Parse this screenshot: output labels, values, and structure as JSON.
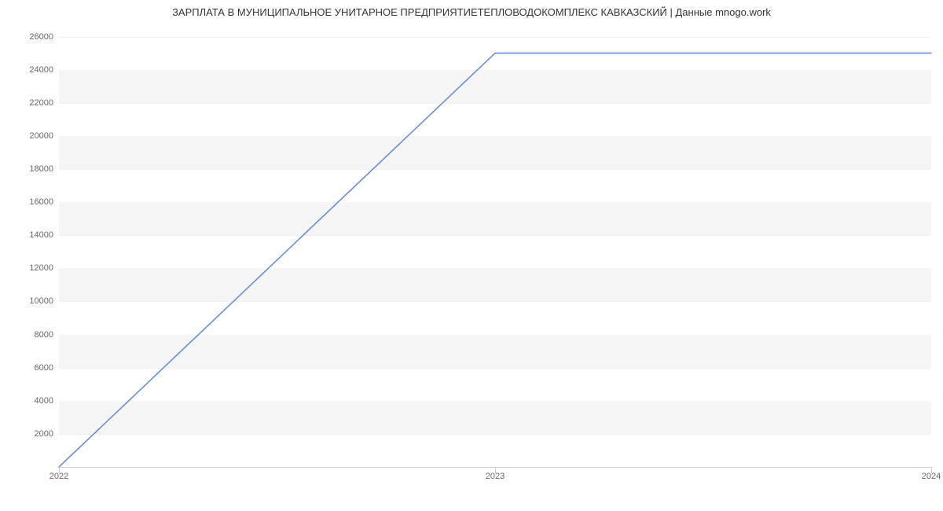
{
  "chart_data": {
    "type": "line",
    "title": "ЗАРПЛАТА В МУНИЦИПАЛЬНОЕ УНИТАРНОЕ ПРЕДПРИЯТИЕТЕПЛОВОДОКОМПЛЕКС КАВКАЗСКИЙ | Данные mnogo.work",
    "xlabel": "",
    "ylabel": "",
    "x": [
      2022,
      2023,
      2024
    ],
    "series": [
      {
        "name": "salary",
        "color": "#6a8fd8",
        "values": [
          0,
          25000,
          25000
        ]
      }
    ],
    "x_ticks": [
      "2022",
      "2023",
      "2024"
    ],
    "y_ticks": [
      2000,
      4000,
      6000,
      8000,
      10000,
      12000,
      14000,
      16000,
      18000,
      20000,
      22000,
      24000,
      26000
    ],
    "xlim": [
      2022,
      2024
    ],
    "ylim": [
      0,
      26500
    ]
  }
}
